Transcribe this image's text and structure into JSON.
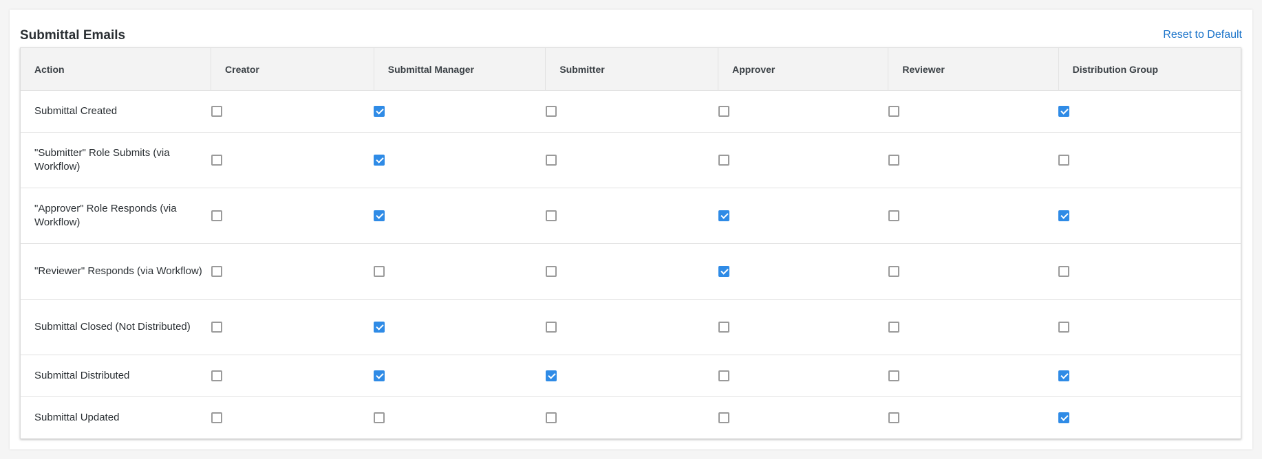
{
  "panel": {
    "title": "Submittal Emails",
    "reset_label": "Reset to Default"
  },
  "columns": [
    "Action",
    "Creator",
    "Submittal Manager",
    "Submitter",
    "Approver",
    "Reviewer",
    "Distribution Group"
  ],
  "rows": [
    {
      "action": "Submittal Created",
      "checks": [
        false,
        true,
        false,
        false,
        false,
        true
      ]
    },
    {
      "action": "\"Submitter\" Role Submits (via Workflow)",
      "checks": [
        false,
        true,
        false,
        false,
        false,
        false
      ]
    },
    {
      "action": "\"Approver\" Role Responds (via Workflow)",
      "checks": [
        false,
        true,
        false,
        true,
        false,
        true
      ]
    },
    {
      "action": "\"Reviewer\" Responds (via Workflow)",
      "checks": [
        false,
        false,
        false,
        true,
        false,
        false
      ]
    },
    {
      "action": "Submittal Closed (Not Distributed)",
      "checks": [
        false,
        true,
        false,
        false,
        false,
        false
      ]
    },
    {
      "action": "Submittal Distributed",
      "checks": [
        false,
        true,
        true,
        false,
        false,
        true
      ]
    },
    {
      "action": "Submittal Updated",
      "checks": [
        false,
        false,
        false,
        false,
        false,
        true
      ]
    }
  ],
  "colors": {
    "checkbox_checked": "#2f8be6",
    "link": "#1a73c9"
  }
}
